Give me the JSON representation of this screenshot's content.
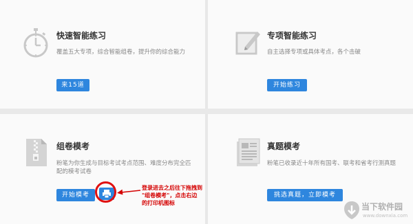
{
  "cards": {
    "quick": {
      "title": "快速智能练习",
      "desc": "覆盖五大专项，综合智能组卷，提升你的综合能力",
      "button": "来15道"
    },
    "special": {
      "title": "专项智能练习",
      "desc": "自主选择专项或具体考点，各个击破",
      "button": "开始练习"
    },
    "mock": {
      "title": "组卷模考",
      "desc_lines": [
        "粉笔为你生成与目标考试考点范围、难度分布完全匹",
        "配的模考试卷"
      ],
      "button": "开始模考"
    },
    "real": {
      "title": "真题模考",
      "desc": "粉笔已收录近十年所有国考、联考和省考行测真题",
      "button": "挑选真题，立即模考"
    }
  },
  "annotation": {
    "lines": [
      "登录进去之后往下拖拽到",
      "\"组卷模考\"，点击右边",
      "的打印机图标"
    ]
  },
  "watermark": {
    "name": "当下软件园",
    "url": "www.downxia.com"
  },
  "colors": {
    "button": "#2e86de",
    "annotation": "#d40000"
  }
}
